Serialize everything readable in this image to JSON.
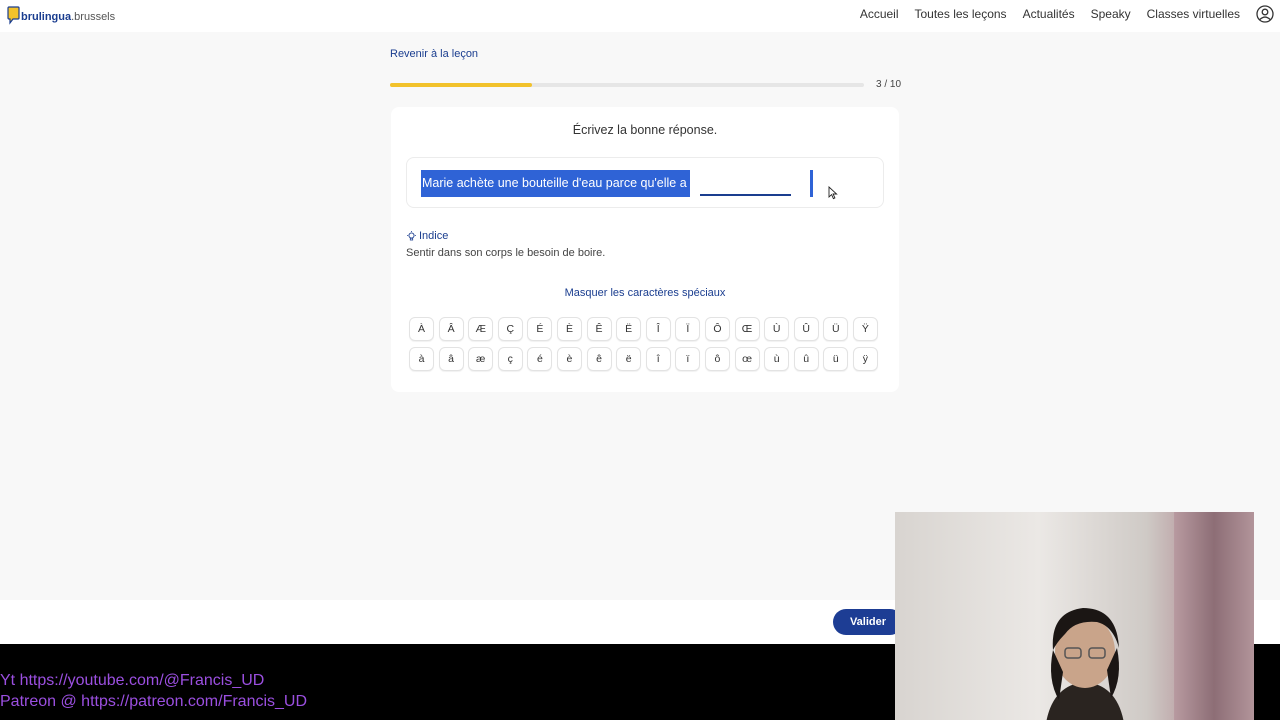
{
  "header": {
    "logo_text_brand": "brulingua",
    "logo_text_domain": ".brussels",
    "nav": [
      "Accueil",
      "Toutes les leçons",
      "Actualités",
      "Speaky",
      "Classes virtuelles"
    ],
    "user_icon": "user-circle-icon"
  },
  "lesson": {
    "back_label": "Revenir à la leçon",
    "progress_fraction": 0.3,
    "progress_label": "3 / 10",
    "instruction": "Écrivez la bonne réponse.",
    "sentence": "Marie achète une bouteille d'eau parce qu'elle a",
    "answer_value": "",
    "hint_label": "Indice",
    "hint_text": "Sentir dans son corps le besoin de boire.",
    "toggle_special_label": "Masquer les caractères spéciaux",
    "upper_chars": [
      "À",
      "Â",
      "Æ",
      "Ç",
      "É",
      "È",
      "Ê",
      "Ë",
      "Î",
      "Ï",
      "Ô",
      "Œ",
      "Ù",
      "Û",
      "Ü",
      "Ÿ"
    ],
    "lower_chars": [
      "à",
      "â",
      "æ",
      "ç",
      "é",
      "è",
      "ê",
      "ë",
      "î",
      "ï",
      "ô",
      "œ",
      "ù",
      "û",
      "ü",
      "ÿ"
    ],
    "validate_label": "Valider"
  },
  "overlay": {
    "line1": "Yt https://youtube.com/@Francis_UD",
    "line2": "Patreon @ https://patreon.com/Francis_UD"
  },
  "colors": {
    "brand_blue": "#1a3d8f",
    "progress_yellow": "#f2c22b",
    "selection_blue": "#2f63d6",
    "overlay_purple": "#9b4fe0"
  }
}
